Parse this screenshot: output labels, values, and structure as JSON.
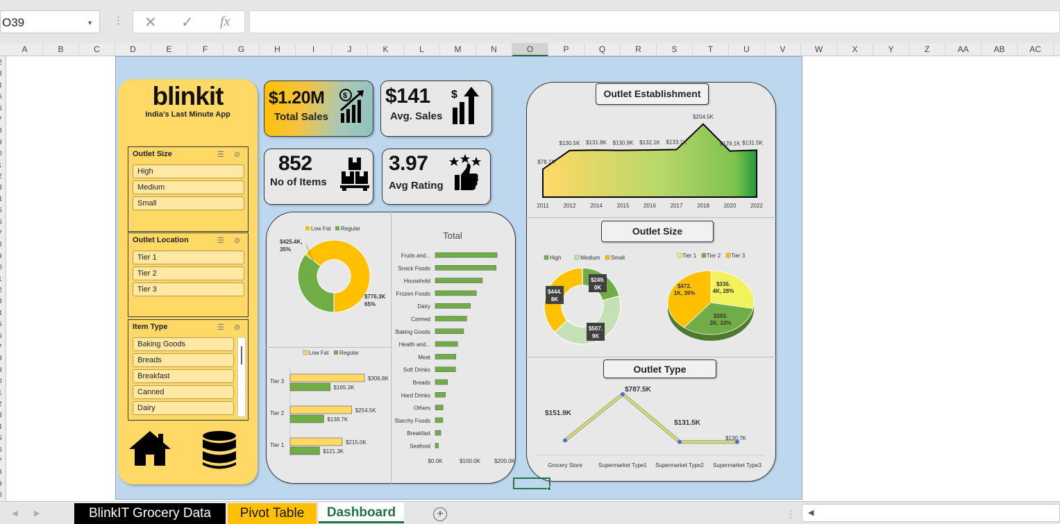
{
  "app": {
    "name_box": "O39",
    "formula_icons": {
      "cancel": "✕",
      "enter": "✓",
      "fx": "fx"
    },
    "column_headers": [
      "A",
      "B",
      "C",
      "D",
      "E",
      "F",
      "G",
      "H",
      "I",
      "J",
      "K",
      "L",
      "M",
      "N",
      "O",
      "P",
      "Q",
      "R",
      "S",
      "T",
      "U",
      "V",
      "W",
      "X",
      "Y",
      "Z",
      "AA",
      "AB",
      "AC"
    ],
    "row_headers": [
      "2",
      "3",
      "4",
      "5",
      "6",
      "7",
      "8",
      "9",
      "0",
      "1",
      "2",
      "3",
      "4",
      "5",
      "6",
      "7",
      "8",
      "9",
      "0",
      "1",
      "2",
      "3",
      "4",
      "5",
      "6",
      "7",
      "8",
      "9",
      "0",
      "1",
      "2",
      "3",
      "4",
      "5",
      "6",
      "7",
      "8",
      "9",
      "0"
    ],
    "sheet_tabs": [
      {
        "label": "BlinkIT Grocery Data"
      },
      {
        "label": "Pivot Table"
      },
      {
        "label": "Dashboard"
      }
    ]
  },
  "brand": {
    "name": "blinkit",
    "tagline": "India's Last Minute App"
  },
  "slicers": {
    "outlet_size": {
      "title": "Outlet Size",
      "items": [
        "High",
        "Medium",
        "Small"
      ]
    },
    "outlet_location": {
      "title": "Outlet Location",
      "items": [
        "Tier 1",
        "Tier 2",
        "Tier 3"
      ]
    },
    "item_type": {
      "title": "Item Type",
      "items": [
        "Baking Goods",
        "Breads",
        "Breakfast",
        "Canned",
        "Dairy"
      ]
    }
  },
  "kpis": {
    "total_sales": {
      "value": "$1.20M",
      "label": "Total Sales"
    },
    "avg_sales": {
      "value": "$141",
      "label": "Avg. Sales"
    },
    "items": {
      "value": "852",
      "label": "No of Items"
    },
    "rating": {
      "value": "3.97",
      "label": "Avg Rating"
    }
  },
  "colors": {
    "yellow": "#ffc000",
    "green": "#70ad47",
    "light_green": "#c5e0b4",
    "sidebar": "#ffd966",
    "canvas": "#bdd7ee"
  },
  "chart_data": [
    {
      "type": "pie",
      "title": "",
      "legend": [
        "Low Fat",
        "Regular"
      ],
      "slices": [
        {
          "name": "Regular",
          "value": 425.4,
          "label": "$425.4K, 35%"
        },
        {
          "name": "Low Fat",
          "value": 776.3,
          "label": "$776.3K 65%"
        }
      ]
    },
    {
      "type": "bar",
      "title": "",
      "orientation": "horizontal",
      "legend": [
        "Low Fat",
        "Regular"
      ],
      "categories": [
        "Tier 3",
        "Tier 2",
        "Tier 1"
      ],
      "series": [
        {
          "name": "Low Fat",
          "values": [
            306.8,
            254.5,
            215.0
          ],
          "labels": [
            "$306.8K",
            "$254.5K",
            "$215.0K"
          ]
        },
        {
          "name": "Regular",
          "values": [
            165.3,
            138.7,
            121.3
          ],
          "labels": [
            "$165.3K",
            "$138.7K",
            "$121.3K"
          ]
        }
      ]
    },
    {
      "type": "bar",
      "title": "Total",
      "orientation": "horizontal",
      "categories": [
        "Fruits and...",
        "Snack Foods",
        "Household",
        "Frozen Foods",
        "Dairy",
        "Canned",
        "Baking Goods",
        "Health and...",
        "Meat",
        "Soft Drinks",
        "Breads",
        "Hard Drinks",
        "Others",
        "Starchy Foods",
        "Breakfast",
        "Seafood"
      ],
      "values": [
        178.1,
        175.4,
        135.9,
        118.6,
        101.3,
        90.7,
        81.9,
        64.5,
        59.4,
        58.5,
        35.4,
        29.3,
        22.5,
        21.9,
        16.0,
        9.1
      ],
      "x_ticks": [
        "$0.0K",
        "$100.0K",
        "$200.0K"
      ],
      "xlim": [
        0,
        200
      ]
    },
    {
      "type": "area",
      "title": "Outlet Establishment",
      "x": [
        "2011",
        "2012",
        "2014",
        "2015",
        "2016",
        "2017",
        "2018",
        "2020",
        "2022"
      ],
      "values": [
        78.1,
        130.5,
        131.8,
        130.9,
        132.1,
        133.1,
        204.5,
        129.1,
        131.5
      ],
      "labels": [
        "$78.1K",
        "$130.5K",
        "$131.8K",
        "$130.9K",
        "$132.1K",
        "$133.1K",
        "$204.5K",
        "$129.1K",
        "$131.5K"
      ],
      "ylim": [
        0,
        210
      ]
    },
    {
      "type": "pie",
      "title": "Outlet Size",
      "legend": [
        "High",
        "Medium",
        "Small"
      ],
      "slices": [
        {
          "name": "High",
          "value": 249.0,
          "label": "$249.0K"
        },
        {
          "name": "Medium",
          "value": 507.9,
          "label": "$507.9K"
        },
        {
          "name": "Small",
          "value": 444.8,
          "label": "$444.8K"
        }
      ]
    },
    {
      "type": "pie",
      "title": "",
      "legend": [
        "Tier 1",
        "Tier 2",
        "Tier 3"
      ],
      "slices": [
        {
          "name": "Tier 1",
          "value": 336.4,
          "label": "$336.4K, 28%"
        },
        {
          "name": "Tier 2",
          "value": 393.2,
          "label": "$393.2K, 33%"
        },
        {
          "name": "Tier 3",
          "value": 472.1,
          "label": "$472.1K, 39%"
        }
      ]
    },
    {
      "type": "line",
      "title": "Outlet Type",
      "categories": [
        "Grocery Store",
        "Supermarket Type1",
        "Supermarket Type2",
        "Supermarket Type3"
      ],
      "values": [
        151.9,
        787.5,
        131.5,
        130.7
      ],
      "labels": [
        "$151.9K",
        "$787.5K",
        "$131.5K",
        "$130.7K"
      ]
    }
  ]
}
